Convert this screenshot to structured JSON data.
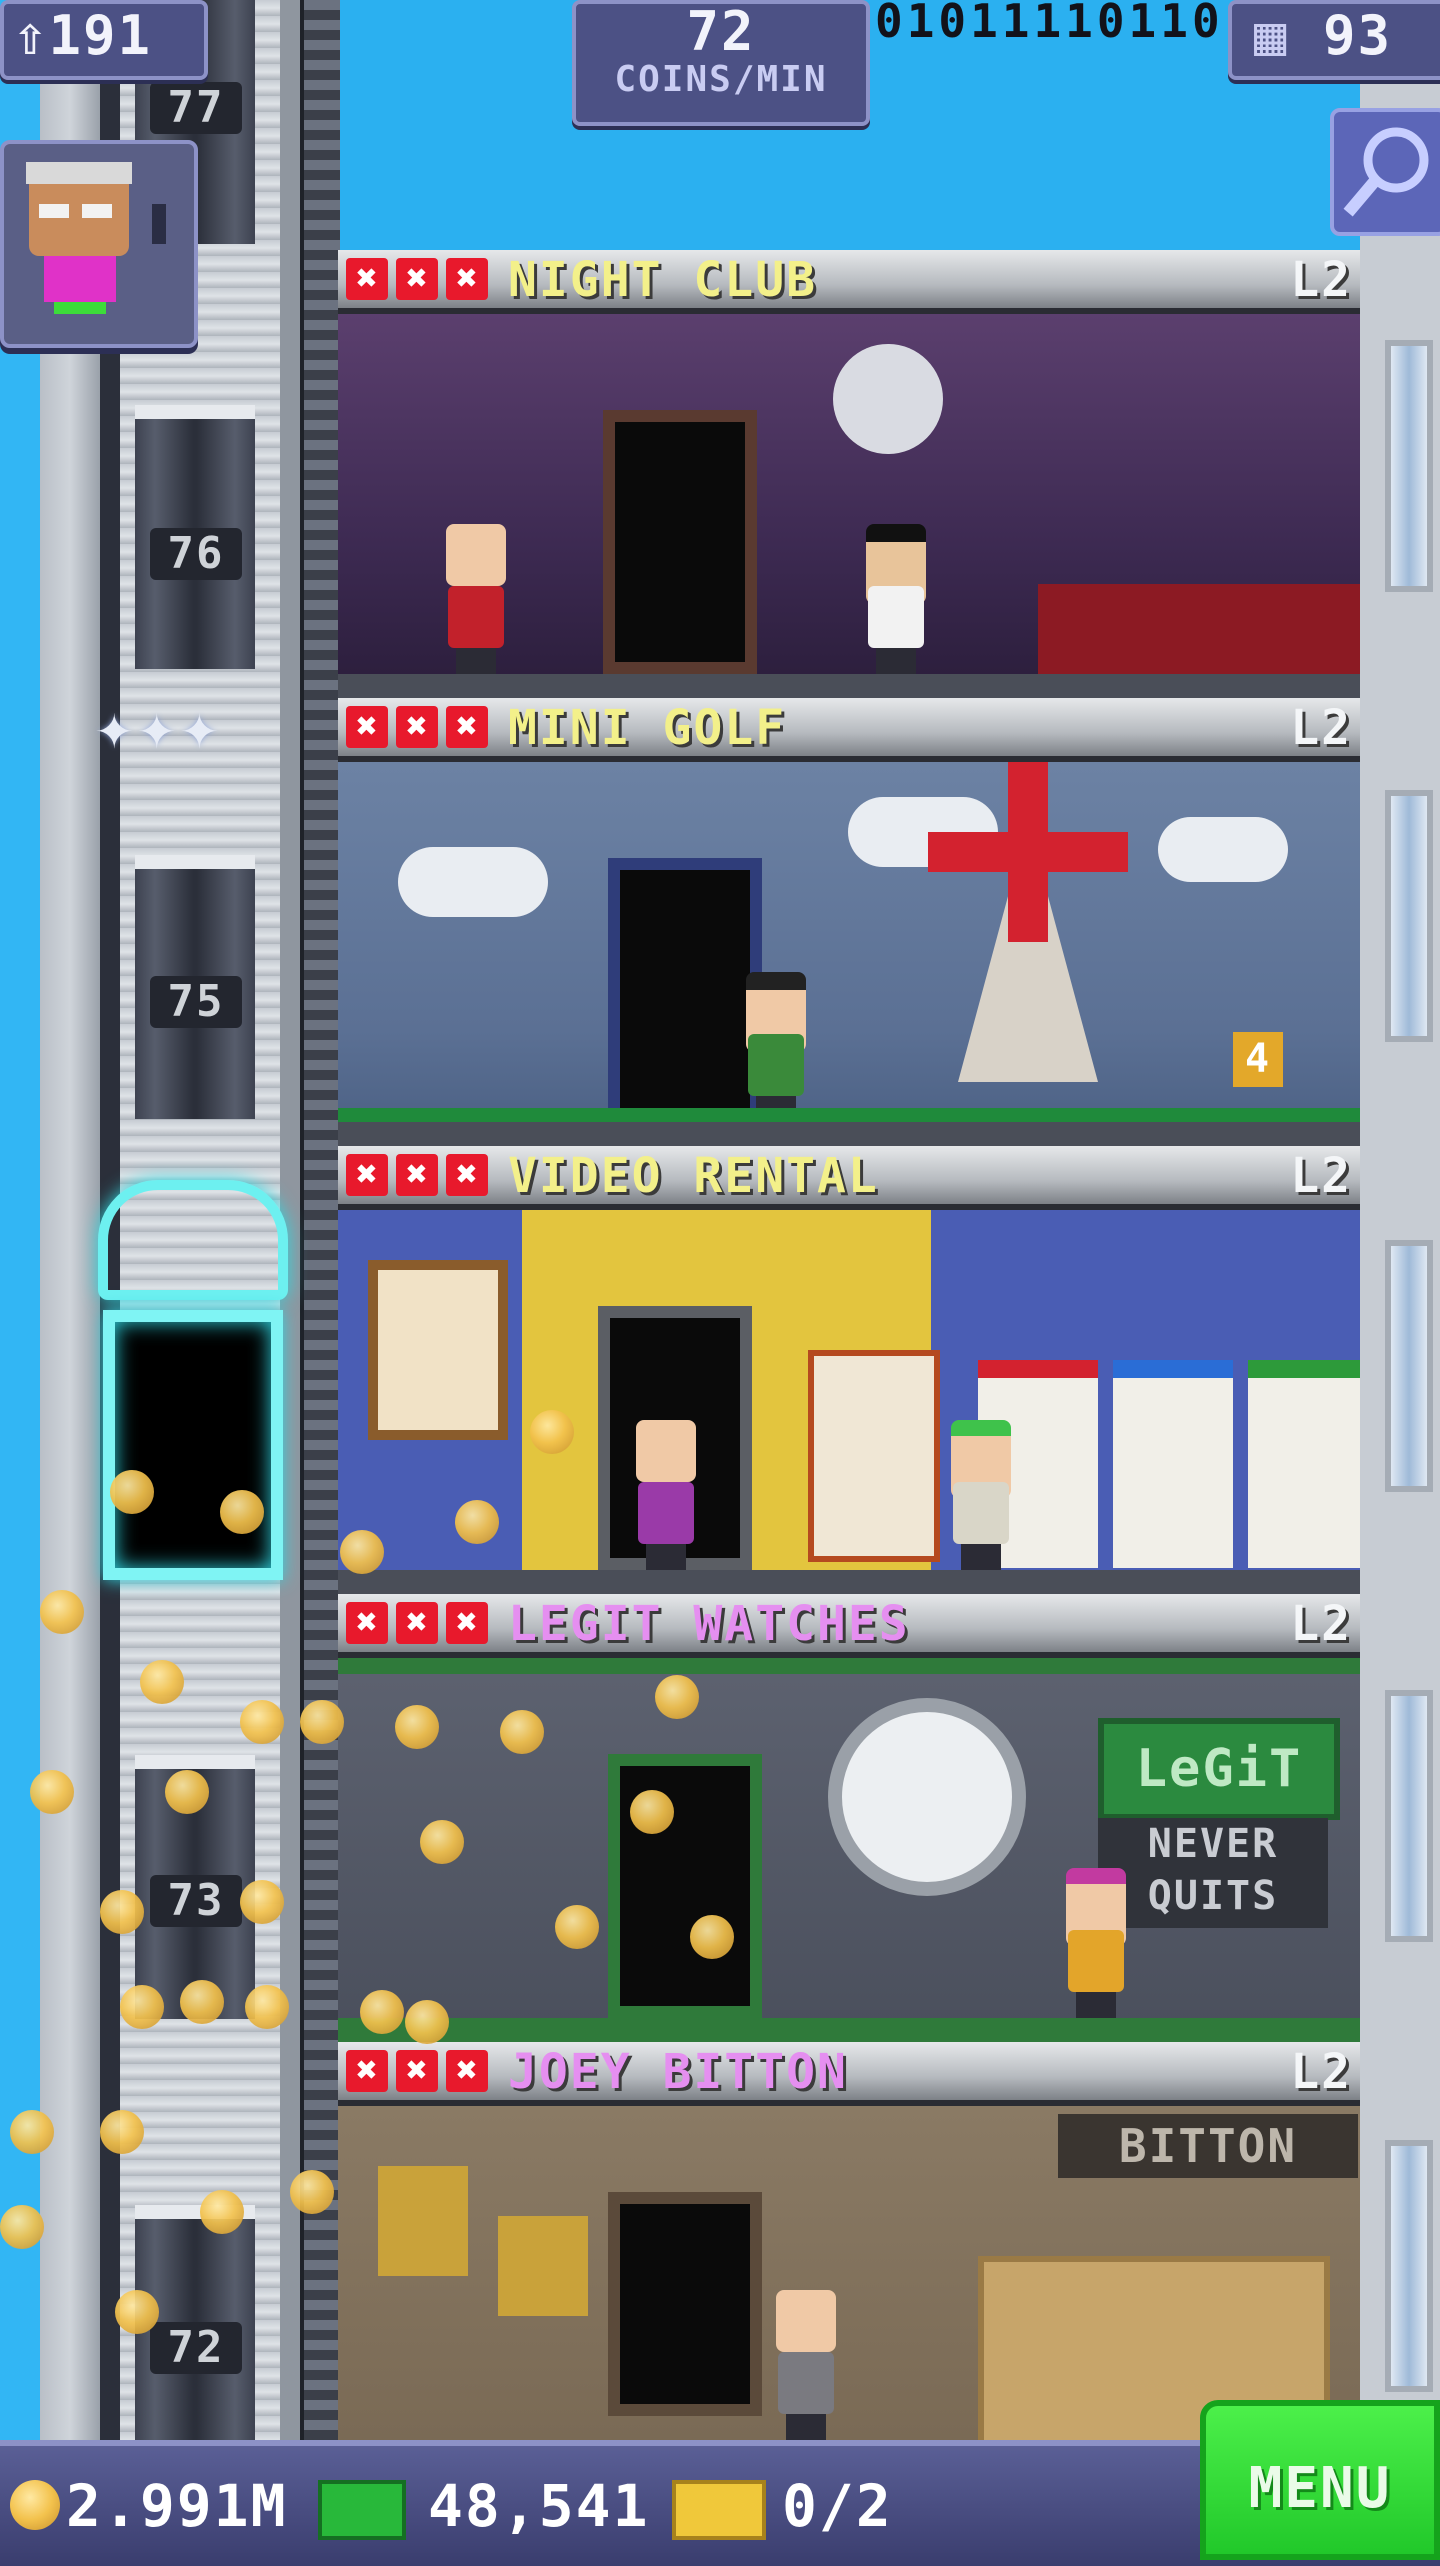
{
  "top_bar": {
    "population": "191",
    "coin_rate_value": "72",
    "coin_rate_unit": "COINS/MIN",
    "floor_count": "93",
    "binary_display": "01011110110"
  },
  "elevator_floor_numbers": [
    "77",
    "76",
    "75",
    "73",
    "72"
  ],
  "floors": [
    {
      "name": "NIGHT CLUB",
      "level": "L2",
      "name_color": "#f3f08a"
    },
    {
      "name": "MINI GOLF",
      "level": "L2",
      "name_color": "#f3f08a"
    },
    {
      "name": "VIDEO RENTAL",
      "level": "L2",
      "name_color": "#f3f08a"
    },
    {
      "name": "LEGIT WATCHES",
      "level": "L2",
      "name_color": "#e58ff0"
    },
    {
      "name": "JOEY BITTON",
      "level": "L2",
      "name_color": "#e58ff0"
    }
  ],
  "floor_x_mark": "✖",
  "signs": {
    "mini_golf_hole": "4",
    "legit_logo": "LeGiT",
    "legit_slogan_1": "NEVER",
    "legit_slogan_2": "QUITS",
    "bitton_sign": "BITTON"
  },
  "bottom_bar": {
    "coins": "2.991M",
    "bux": "48,541",
    "tickets": "0/2",
    "menu_label": "MENU"
  },
  "icons": {
    "population": "person-up-icon",
    "floors": "building-icon",
    "search": "magnifier-icon",
    "coin": "coin-icon",
    "bux": "tower-bux-icon",
    "ticket": "golden-ticket-icon"
  }
}
